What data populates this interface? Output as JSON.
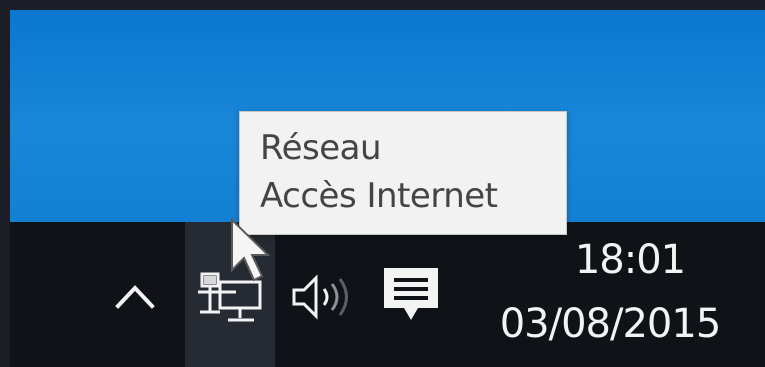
{
  "tooltip": {
    "title": "Réseau",
    "status": "Accès Internet"
  },
  "tray": {
    "icons": {
      "chevron": "chevron-up-icon",
      "network": "network-icon",
      "volume": "volume-icon",
      "action_center": "action-center-icon"
    }
  },
  "clock": {
    "time": "18:01",
    "date": "03/08/2015"
  },
  "colors": {
    "desktop": "#1480d4",
    "taskbar": "#0f1318",
    "hover": "#262b33",
    "tooltip_bg": "#f2f2f2",
    "tooltip_text": "#444444",
    "tray_fg": "#f3f3f3"
  }
}
